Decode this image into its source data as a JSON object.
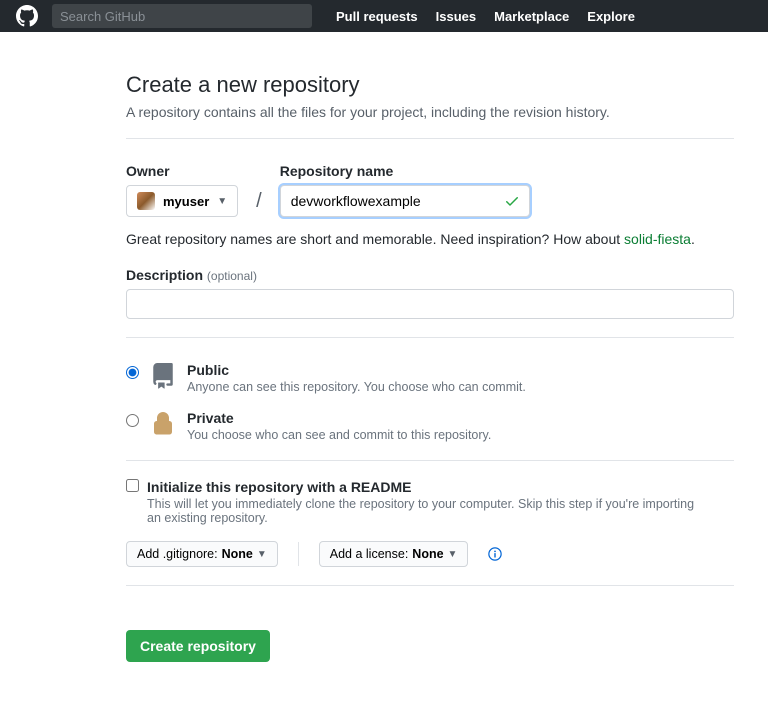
{
  "header": {
    "search_placeholder": "Search GitHub",
    "nav": [
      "Pull requests",
      "Issues",
      "Marketplace",
      "Explore"
    ]
  },
  "page": {
    "title": "Create a new repository",
    "subtitle": "A repository contains all the files for your project, including the revision history."
  },
  "owner": {
    "label": "Owner",
    "name": "myuser"
  },
  "repo": {
    "label": "Repository name",
    "value": "devworkflowexample"
  },
  "hint": {
    "text_prefix": "Great repository names are short and memorable. Need inspiration? How about ",
    "suggestion": "solid-fiesta",
    "suffix": "."
  },
  "description": {
    "label": "Description",
    "optional": "(optional)",
    "value": ""
  },
  "visibility": {
    "public": {
      "title": "Public",
      "desc": "Anyone can see this repository. You choose who can commit."
    },
    "private": {
      "title": "Private",
      "desc": "You choose who can see and commit to this repository."
    },
    "selected": "public"
  },
  "init": {
    "title": "Initialize this repository with a README",
    "desc": "This will let you immediately clone the repository to your computer. Skip this step if you're importing an existing repository.",
    "checked": false
  },
  "selects": {
    "gitignore_prefix": "Add .gitignore: ",
    "gitignore_value": "None",
    "license_prefix": "Add a license: ",
    "license_value": "None"
  },
  "actions": {
    "create": "Create repository"
  },
  "colors": {
    "accent": "#2ea44f",
    "link": "#0366d6"
  }
}
